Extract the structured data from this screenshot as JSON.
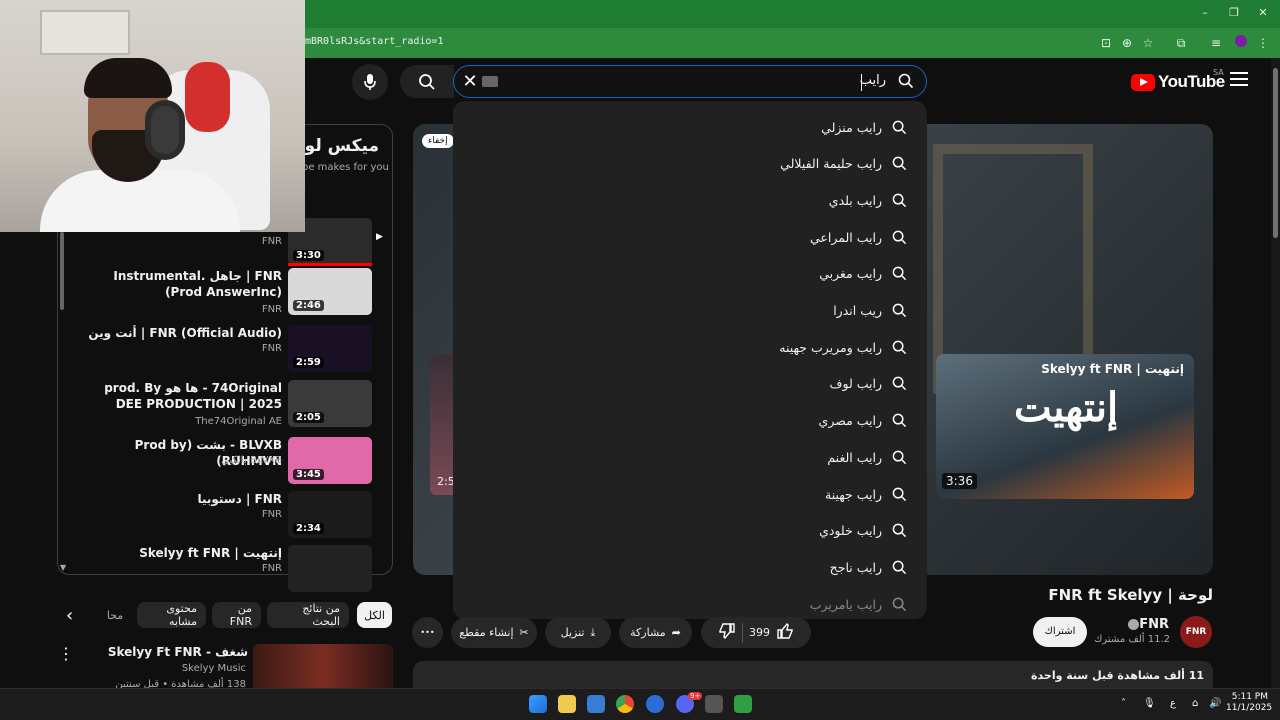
{
  "browser": {
    "url": "mBR0lsRJs&start_radio=1",
    "window_controls": [
      "–",
      "❐",
      "✕"
    ]
  },
  "header": {
    "logo_text": "YouTube",
    "region": "SA",
    "search_query": "رايب"
  },
  "suggestions": [
    "رايب منزلي",
    "رايب حليمة الفيلالي",
    "رايب بلدي",
    "رايب المراعي",
    "رايب مغربي",
    "ريب اندرا",
    "رايب ومريرب جهينه",
    "رايب لوف",
    "رايب مصري",
    "رايب الغنم",
    "رايب جهينة",
    "رايب خلودي",
    "رايب ناجح",
    "رايب يامريرب"
  ],
  "player": {
    "hide_chip": "إخفاء",
    "endcard": {
      "title": "إنتهيت | Skelyy ft FNR",
      "duration": "3:36",
      "art": "إنتهيت"
    },
    "left_card_duration": "2:5"
  },
  "video": {
    "title": "لوحة | FNR ft Skelyy",
    "channel": "FNR",
    "subscribers": "11.2 ألف مشترك",
    "subscribe": "اشتراك",
    "likes": "399",
    "share": "مشاركة",
    "download": "تنزيل",
    "clip": "إنشاء مقطع",
    "more": "•••",
    "description_meta": "11 ألف مشاهدة  قبل سنة واحدة",
    "avatar_text": "FNR"
  },
  "playlist": {
    "title": "ميكس لوح",
    "subtitle": "be makes for you",
    "items": [
      {
        "title": "",
        "channel": "FNR",
        "duration": "3:30",
        "thumb": "#2b2b2b"
      },
      {
        "title": "FNR | جاهل .Instrumental (Prod AnswerInc)",
        "channel": "FNR",
        "duration": "2:46",
        "thumb": "#d9d9d9"
      },
      {
        "title": "FNR (Official Audio) | أنت وين",
        "channel": "FNR",
        "duration": "2:59",
        "thumb": "#1a1024"
      },
      {
        "title": "74Original - ها هو prod. By DEE PRODUCTION | 2025",
        "channel": "The74Original AE",
        "duration": "2:05",
        "thumb": "#3a3a3a"
      },
      {
        "title": "BLVXB - بشت (Prod by RUHMVN)",
        "channel": "BLVXB بالكبي",
        "duration": "3:45",
        "thumb": "#e06aa8"
      },
      {
        "title": "FNR | دستوبيا",
        "channel": "FNR",
        "duration": "2:34",
        "thumb": "#1b1b1b"
      },
      {
        "title": "إنتهيت | Skelyy ft FNR",
        "channel": "FNR",
        "duration": "",
        "thumb": "#222"
      }
    ]
  },
  "chips": [
    "الكل",
    "من نتائج البحث",
    "من FNR",
    "محتوى مشابه",
    "محا"
  ],
  "next_rec": {
    "title": "شغف - Skelyy Ft FNR",
    "channel": "Skelyy Music",
    "meta": "138 ألف مشاهدة • قبل سنتين"
  },
  "taskbar": {
    "time": "5:11 PM",
    "date": "11/1/2025",
    "lang": "ع",
    "discord_badge": "9+"
  },
  "colors": {
    "youtube_red": "#ff0000",
    "search_border": "#1c62b9",
    "browser_green": "#2e8b3e"
  }
}
